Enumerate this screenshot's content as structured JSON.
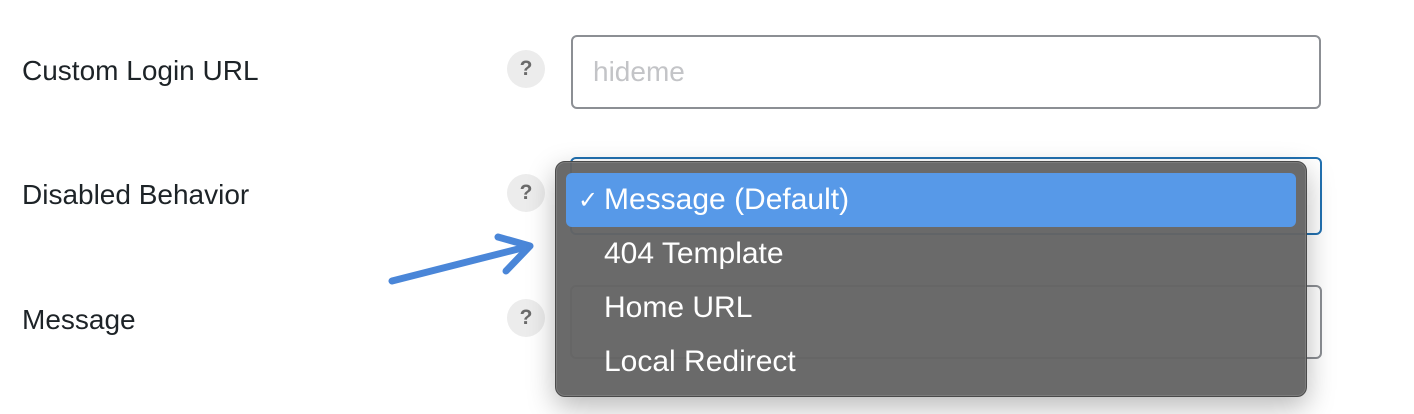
{
  "fields": {
    "custom_login_url": {
      "label": "Custom Login URL",
      "help": "?",
      "placeholder": "hideme"
    },
    "disabled_behavior": {
      "label": "Disabled Behavior",
      "help": "?"
    },
    "message": {
      "label": "Message",
      "help": "?"
    }
  },
  "dropdown": {
    "check_mark": "✓",
    "options": [
      {
        "label": "Message (Default)",
        "selected": true
      },
      {
        "label": "404 Template",
        "selected": false
      },
      {
        "label": "Home URL",
        "selected": false
      },
      {
        "label": "Local Redirect",
        "selected": false
      }
    ]
  },
  "colors": {
    "selected_highlight": "#5799e8",
    "focus_border": "#2271b1",
    "arrow": "#4a86d8",
    "menu_background": "#646464"
  },
  "icons": {
    "help": "question-mark-icon",
    "arrow": "pointer-arrow-icon"
  }
}
